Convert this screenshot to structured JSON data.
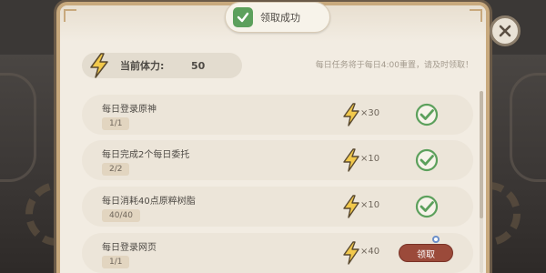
{
  "toast": {
    "message": "领取成功",
    "icon": "checkmark-icon"
  },
  "stamina": {
    "label": "当前体力:",
    "value": "50",
    "icon": "lightning-icon"
  },
  "notice": "每日任务将于每日4:00重置，请及时领取！",
  "tasks": [
    {
      "name": "每日登录原神",
      "progress": "1/1",
      "reward": "×30",
      "state": "claimed"
    },
    {
      "name": "每日完成2个每日委托",
      "progress": "2/2",
      "reward": "×10",
      "state": "claimed"
    },
    {
      "name": "每日消耗40点原粹树脂",
      "progress": "40/40",
      "reward": "×10",
      "state": "claimed"
    },
    {
      "name": "每日登录网页",
      "progress": "1/1",
      "reward": "×40",
      "state": "claimable",
      "claim_label": "领取"
    }
  ],
  "colors": {
    "panel_bg": "#f2ece2",
    "row_bg": "#ece5d9",
    "bolt_yellow": "#f2c94c",
    "check_green": "#5ca05c",
    "claim_red": "#9b4a3a"
  }
}
